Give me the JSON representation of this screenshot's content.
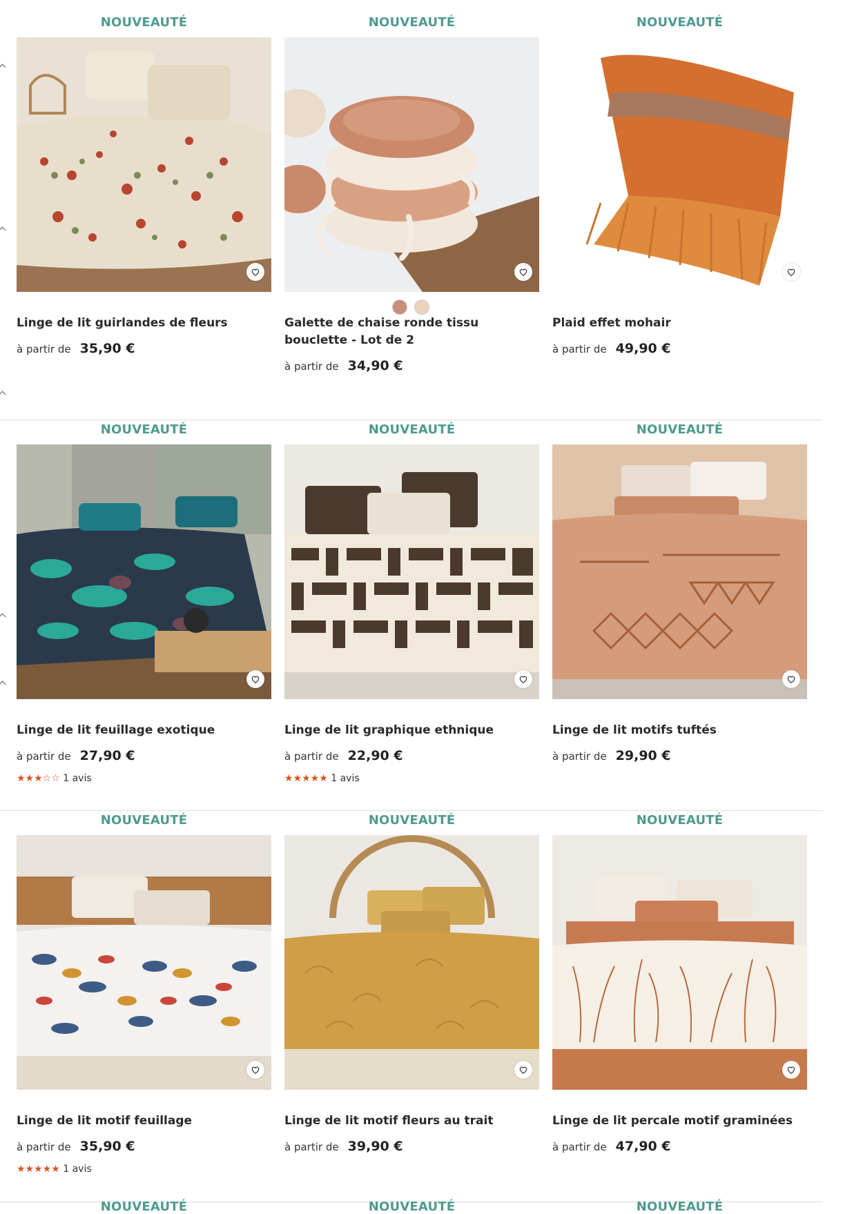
{
  "badge_label": "NOUVEAUTÉ",
  "price_prefix": "à partir de",
  "colors": {
    "badge": "#4f9a8f",
    "star": "#d9531e"
  },
  "products": [
    {
      "title": "Linge de lit guirlandes de fleurs",
      "price": "35,90 €",
      "image": "floral-bedding"
    },
    {
      "title": "Galette de chaise ronde tissu bouclette - Lot de 2",
      "price": "34,90 €",
      "image": "boucle-cushions",
      "swatches": [
        "#c88e78",
        "#ead2bd"
      ]
    },
    {
      "title": "Plaid effet mohair",
      "price": "49,90 €",
      "image": "mohair-throw"
    },
    {
      "title": "Linge de lit feuillage exotique",
      "price": "27,90 €",
      "image": "exotic-bedding",
      "rating_stars": 3,
      "reviews": "1 avis"
    },
    {
      "title": "Linge de lit graphique ethnique",
      "price": "22,90 €",
      "image": "ethnic-bedding",
      "rating_stars": 5,
      "reviews": "1 avis"
    },
    {
      "title": "Linge de lit motifs tuftés",
      "price": "29,90 €",
      "image": "tufted-bedding"
    },
    {
      "title": "Linge de lit motif feuillage",
      "price": "35,90 €",
      "image": "foliage-bedding",
      "rating_stars": 5,
      "reviews": "1 avis"
    },
    {
      "title": "Linge de lit motif fleurs au trait",
      "price": "39,90 €",
      "image": "ochre-bedding"
    },
    {
      "title": "Linge de lit percale motif graminées",
      "price": "47,90 €",
      "image": "grass-bedding"
    }
  ]
}
